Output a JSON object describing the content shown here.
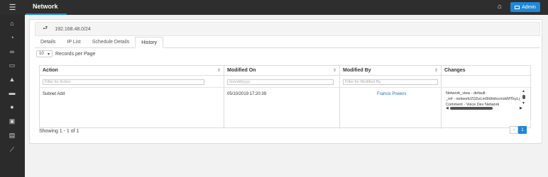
{
  "header": {
    "title": "Network",
    "admin_label": "Admin"
  },
  "breadcrumb": {
    "network": "192.168.48.0/24"
  },
  "tabs": [
    {
      "label": "Details"
    },
    {
      "label": "IP List"
    },
    {
      "label": "Schedule Details"
    },
    {
      "label": "History",
      "active": true
    }
  ],
  "records_per_page": {
    "value": "10",
    "label": "Records per Page"
  },
  "table": {
    "columns": [
      "Action",
      "Modified On",
      "Modified By",
      "Changes"
    ],
    "filters": {
      "action": "Filter for Action",
      "modified_on": "mm/dd/yyyy",
      "modified_by": "Filter for Modified By"
    },
    "rows": [
      {
        "action": "Subnet Add",
        "modified_on": "05/10/2019 17:20:39",
        "modified_by": "Francis Powers",
        "changes": [
          "Network_view - default",
          "_ref - network/ZG5zLm5ldHdvcmskMTkyLj",
          "Comment - Voice Dev Network"
        ]
      }
    ]
  },
  "footer": {
    "showing": "Showing 1 - 1 of 1",
    "current_page": "1"
  },
  "colors": {
    "accent": "#1e88d8",
    "topbar": "#2e2e2e",
    "sidebar": "#2b2b2b",
    "link": "#1e6fb8"
  },
  "sidebar_icons": [
    "home-icon",
    "dashboard-icon",
    "binoculars-icon",
    "ipam-icon",
    "alert-icon",
    "monitor-icon",
    "users-icon",
    "briefcase-icon",
    "book-icon",
    "chart-icon"
  ]
}
